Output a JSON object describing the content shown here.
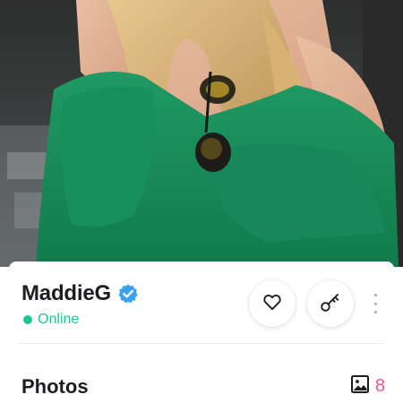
{
  "profile": {
    "name": "MaddieG",
    "verified": true,
    "status": "Online",
    "status_color": "#1fc493",
    "verified_color": "#3aa2ef"
  },
  "actions": {
    "like_icon": "heart-outline-icon",
    "key_icon": "key-icon",
    "more_icon": "vertical-dots-icon"
  },
  "photos": {
    "title": "Photos",
    "icon": "image-icon",
    "count": "8",
    "count_color": "#e8579b"
  }
}
